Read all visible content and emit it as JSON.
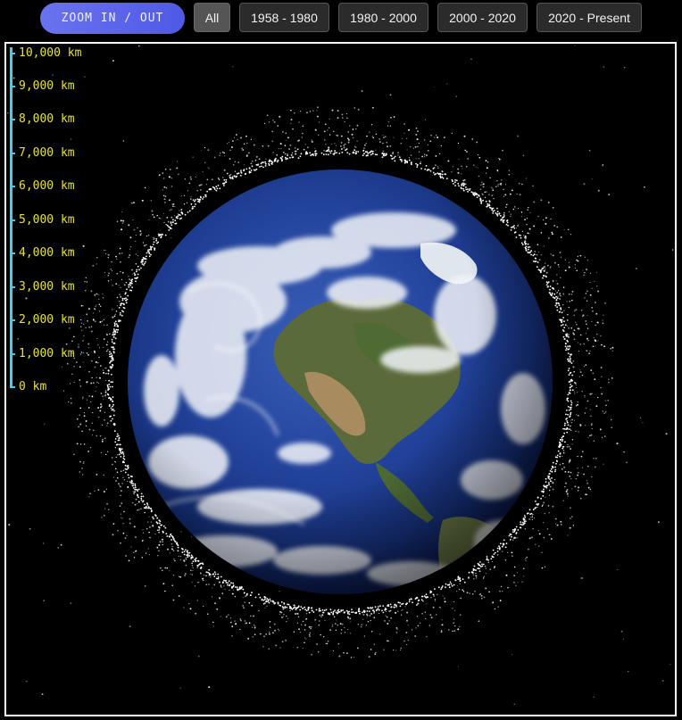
{
  "toolbar": {
    "zoom_label": "ZOOM IN / OUT",
    "filters": [
      "All",
      "1958 - 1980",
      "1980 - 2000",
      "2000 - 2020",
      "2020 - Present"
    ],
    "active_filter": "All"
  },
  "scale": {
    "labels": [
      "10,000 km",
      "9,000 km",
      "8,000 km",
      "7,000 km",
      "6,000 km",
      "5,000 km",
      "4,000 km",
      "3,000 km",
      "2,000 km",
      "1,000 km",
      "0 km"
    ]
  },
  "colors": {
    "zoom_button": "#5a63ea",
    "scale_line": "#35d6e8",
    "scale_text": "#e8e23a",
    "ocean": "#1f3a8a",
    "debris": "#ffffff"
  },
  "icons": {
    "planet": "earth-icon"
  }
}
